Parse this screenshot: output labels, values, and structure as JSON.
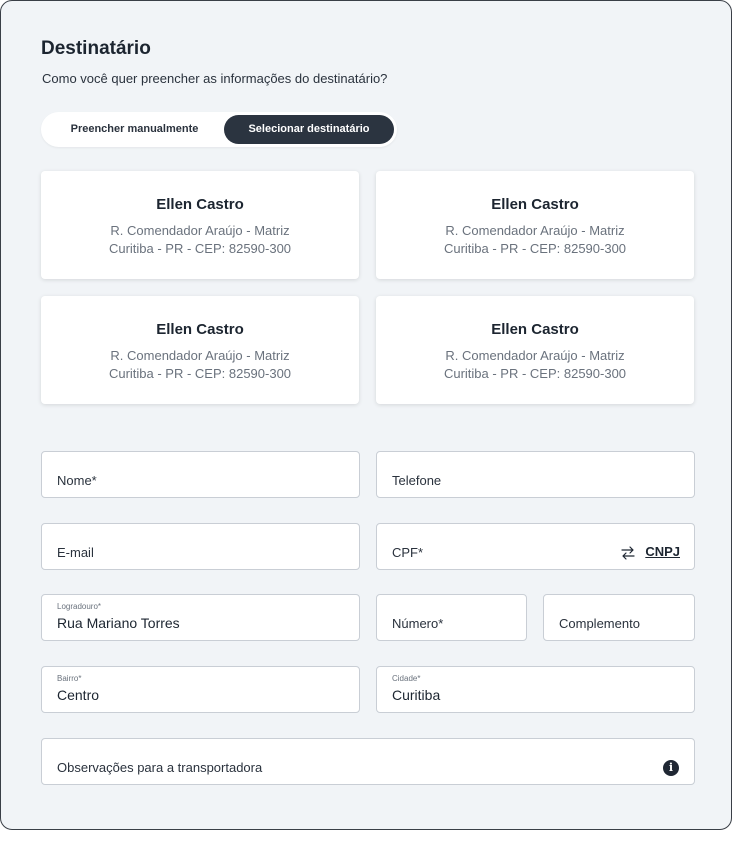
{
  "header": {
    "title": "Destinatário",
    "subtitle": "Como você quer preencher as informações do destinatário?"
  },
  "toggle": {
    "manual_label": "Preencher manualmente",
    "select_label": "Selecionar destinatário",
    "selected": "Selecionar destinatário"
  },
  "recipients": [
    {
      "name": "Ellen Castro",
      "street": "R. Comendador Araújo - Matriz",
      "city": "Curitiba - PR - CEP: 82590-300"
    },
    {
      "name": "Ellen Castro",
      "street": "R. Comendador Araújo - Matriz",
      "city": "Curitiba - PR - CEP: 82590-300"
    },
    {
      "name": "Ellen Castro",
      "street": "R. Comendador Araújo - Matriz",
      "city": "Curitiba - PR - CEP: 82590-300"
    },
    {
      "name": "Ellen Castro",
      "street": "R. Comendador Araújo - Matriz",
      "city": "Curitiba - PR - CEP: 82590-300"
    }
  ],
  "form": {
    "nome": {
      "placeholder": "Nome*"
    },
    "telefone": {
      "placeholder": "Telefone"
    },
    "email": {
      "placeholder": "E-mail"
    },
    "cpf": {
      "placeholder": "CPF*",
      "switch_label": "CNPJ"
    },
    "logradouro": {
      "label": "Logradouro*",
      "value": "Rua Mariano Torres"
    },
    "numero": {
      "placeholder": "Número*"
    },
    "complemento": {
      "placeholder": "Complemento"
    },
    "bairro": {
      "label": "Bairro*",
      "value": "Centro"
    },
    "cidade": {
      "label": "Cidade*",
      "value": "Curitiba"
    },
    "observacoes": {
      "placeholder": "Observações para a transportadora"
    }
  },
  "icons": {
    "swap": "swap-arrows-icon",
    "info": "info-icon"
  },
  "colors": {
    "panel_bg": "#f1f4f7",
    "toggle_active_bg": "#2b3440",
    "text_dark": "#1c2530",
    "text_muted": "#6a727d"
  }
}
